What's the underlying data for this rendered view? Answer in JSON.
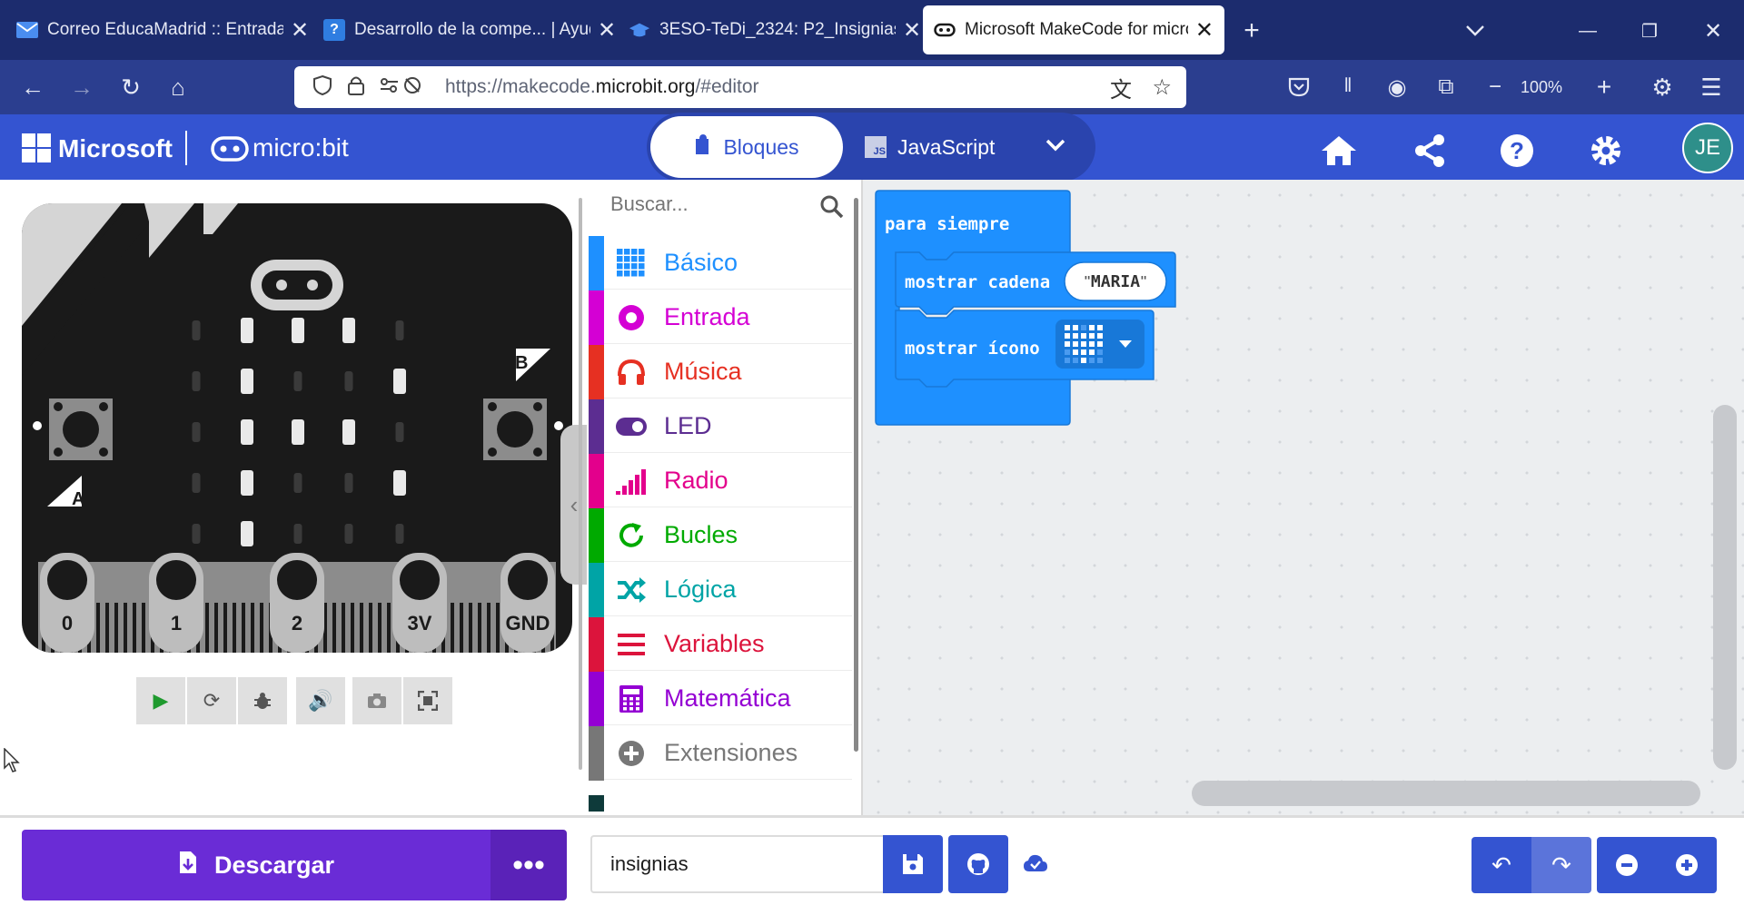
{
  "browser": {
    "tabs": [
      {
        "title": "Correo EducaMadrid :: Entrada",
        "favicon": "mail-icon"
      },
      {
        "title": "Desarrollo de la compe... | Ayuda",
        "favicon": "help-icon"
      },
      {
        "title": "3ESO-TeDi_2324: P2_Insignias |",
        "favicon": "cap-icon"
      },
      {
        "title": "Microsoft MakeCode for micro:bit",
        "favicon": "microbit-icon"
      }
    ],
    "url_prefix": "https://makecode.",
    "url_domain": "microbit.org",
    "url_suffix": "/#editor",
    "zoom": "100%"
  },
  "header": {
    "brand_microsoft": "Microsoft",
    "brand_microbit": "micro:bit",
    "blocks_label": "Bloques",
    "js_label": "JavaScript",
    "js_badge": "JS",
    "avatar": "JE"
  },
  "simulator": {
    "pins": [
      "0",
      "1",
      "2",
      "3V",
      "GND"
    ],
    "button_a": "A",
    "button_b": "B"
  },
  "toolbox": {
    "search_placeholder": "Buscar...",
    "categories": [
      {
        "label": "Básico",
        "color": "#1e90ff"
      },
      {
        "label": "Entrada",
        "color": "#d400d4"
      },
      {
        "label": "Música",
        "color": "#e63022"
      },
      {
        "label": "LED",
        "color": "#5c2d91"
      },
      {
        "label": "Radio",
        "color": "#e3008c"
      },
      {
        "label": "Bucles",
        "color": "#00aa00"
      },
      {
        "label": "Lógica",
        "color": "#00a4a6"
      },
      {
        "label": "Variables",
        "color": "#dc143c"
      },
      {
        "label": "Matemática",
        "color": "#9400d3"
      },
      {
        "label": "Extensiones",
        "color": "#777777"
      }
    ]
  },
  "workspace": {
    "forever_label": "para siempre",
    "show_string_label": "mostrar cadena",
    "show_string_value": "MARIA",
    "show_icon_label": "mostrar ícono"
  },
  "bottom": {
    "download_label": "Descargar",
    "project_name": "insignias"
  }
}
